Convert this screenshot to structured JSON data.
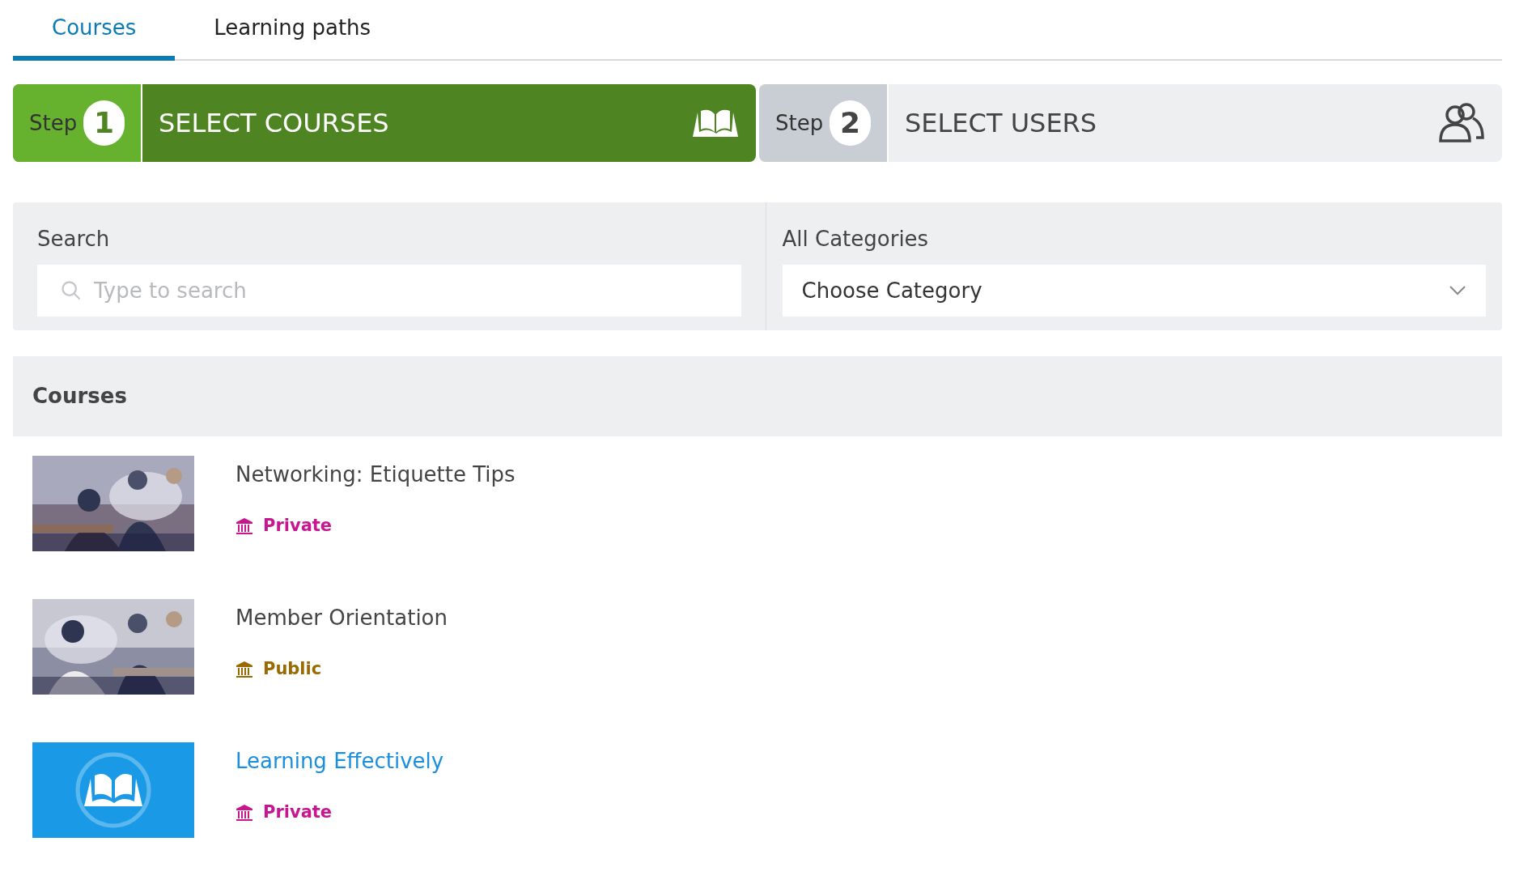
{
  "tabs": [
    {
      "label": "Courses",
      "selected": true
    },
    {
      "label": "Learning paths",
      "selected": false
    }
  ],
  "steps": [
    {
      "prefix": "Step",
      "number": "1",
      "label": "SELECT COURSES",
      "active": true,
      "kind": "courses"
    },
    {
      "prefix": "Step",
      "number": "2",
      "label": "SELECT USERS",
      "active": false,
      "kind": "users"
    }
  ],
  "filters": {
    "search": {
      "label": "Search",
      "placeholder": "Type to search"
    },
    "category": {
      "label": "All Categories",
      "value": "Choose Category"
    }
  },
  "courses": {
    "heading": "Courses",
    "rows": [
      {
        "title": "Networking: Etiquette Tips",
        "hovered": false,
        "visibility": "Private",
        "color": "#c7168f"
      },
      {
        "title": "Member Orientation",
        "hovered": false,
        "visibility": "Public",
        "color": "#9a6a00"
      },
      {
        "title": "Learning Effectively",
        "hovered": true,
        "kind": "logo",
        "visibility": "Private",
        "color": "#c7168f"
      }
    ]
  }
}
